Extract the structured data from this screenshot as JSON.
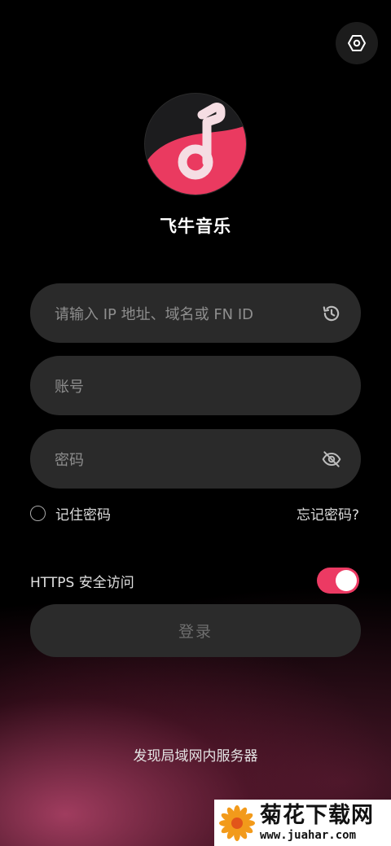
{
  "app": {
    "name": "飞牛音乐",
    "logo_icon": "music-note-logo-icon",
    "accent_color": "#ec3a63"
  },
  "header": {
    "settings_icon": "settings-hexagon-icon"
  },
  "login_form": {
    "server_field": {
      "placeholder": "请输入 IP 地址、域名或 FN ID",
      "value": "",
      "icon": "history-icon"
    },
    "account_field": {
      "placeholder": "账号",
      "value": ""
    },
    "password_field": {
      "placeholder": "密码",
      "value": "",
      "icon": "eye-off-icon"
    },
    "remember_password": {
      "label": "记住密码",
      "checked": false
    },
    "forgot_password_label": "忘记密码?",
    "https": {
      "label": "HTTPS 安全访问",
      "enabled": true
    },
    "login_button_label": "登录"
  },
  "footer": {
    "discover_label": "发现局域网内服务器"
  },
  "watermark": {
    "title": "菊花下载网",
    "url": "www.juahar.com"
  }
}
